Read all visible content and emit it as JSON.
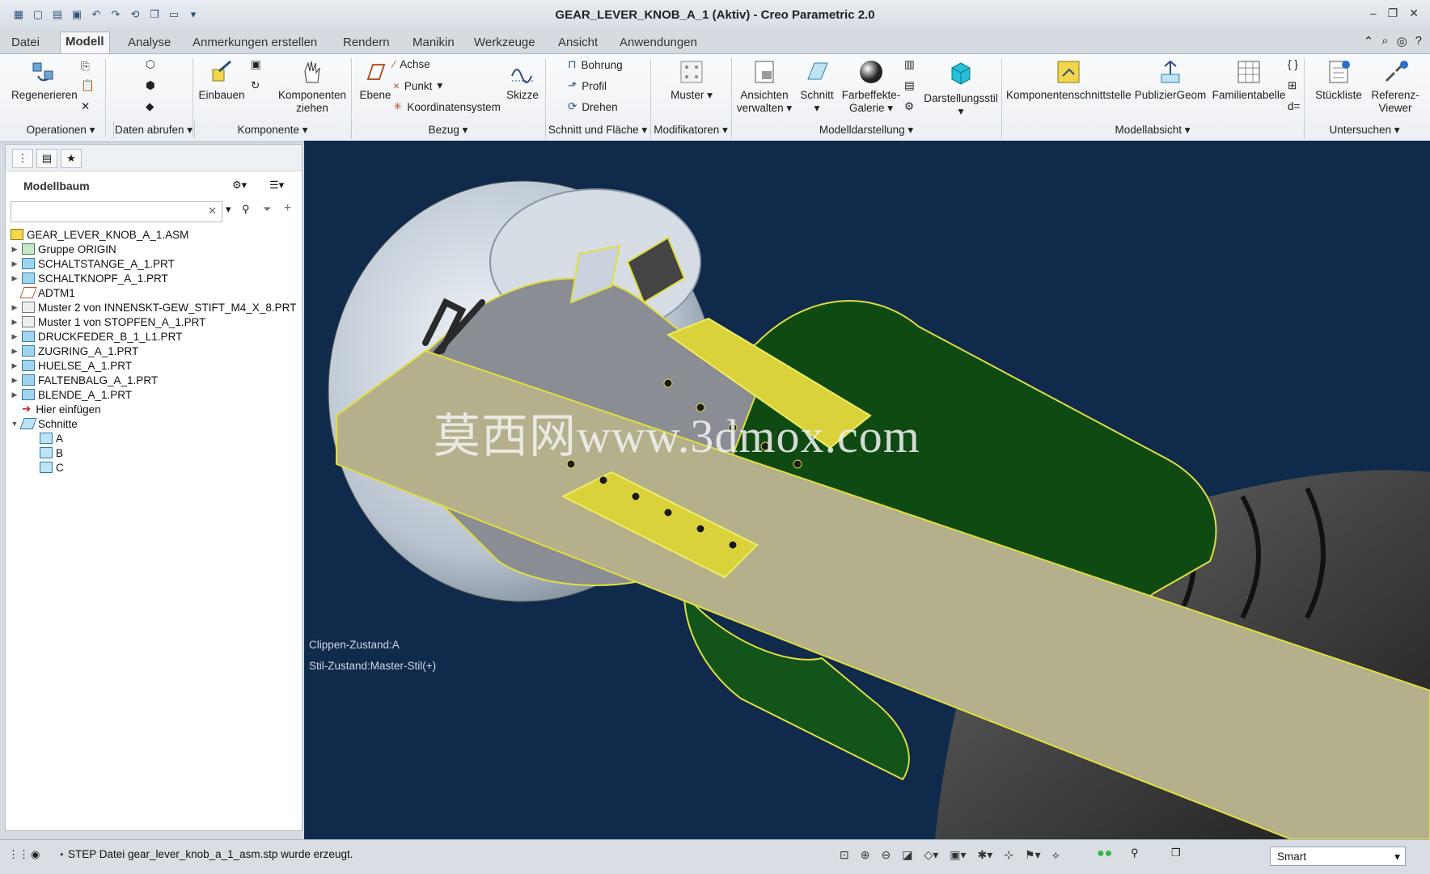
{
  "window": {
    "title": "GEAR_LEVER_KNOB_A_1 (Aktiv) - Creo Parametric 2.0"
  },
  "tabs": [
    "Datei",
    "Modell",
    "Analyse",
    "Anmerkungen erstellen",
    "Rendern",
    "Manikin",
    "Werkzeuge",
    "Ansicht",
    "Anwendungen"
  ],
  "ribbon": {
    "regenerieren": "Regenerieren",
    "einbauen": "Einbauen",
    "komponenten_ziehen_1": "Komponenten",
    "komponenten_ziehen_2": "ziehen",
    "ebene": "Ebene",
    "achse": "Achse",
    "punkt": "Punkt",
    "koordinatensystem": "Koordinatensystem",
    "skizze": "Skizze",
    "bohrung": "Bohrung",
    "profil": "Profil",
    "drehen": "Drehen",
    "muster": "Muster",
    "ansichten_1": "Ansichten",
    "ansichten_2": "verwalten",
    "schnitt": "Schnitt",
    "farbeffekte_1": "Farbeffekte-",
    "farbeffekte_2": "Galerie",
    "darstellungsstil": "Darstellungsstil",
    "komponentenschnittstelle": "Komponentenschnittstelle",
    "publiziergeom": "PublizierGeom",
    "familientabelle": "Familientabelle",
    "stueckliste": "Stückliste",
    "referenz_1": "Referenz-",
    "referenz_2": "Viewer",
    "d_eq": "d="
  },
  "groups": [
    "Operationen",
    "Daten abrufen",
    "Komponente",
    "Bezug",
    "Schnitt und Fläche",
    "Modifikatoren",
    "Modelldarstellung",
    "Modellabsicht",
    "Untersuchen"
  ],
  "modelltree": {
    "title": "Modellbaum",
    "items": [
      "GEAR_LEVER_KNOB_A_1.ASM",
      "Gruppe ORIGIN",
      "SCHALTSTANGE_A_1.PRT",
      "SCHALTKNOPF_A_1.PRT",
      "ADTM1",
      "Muster 2 von INNENSKT-GEW_STIFT_M4_X_8.PRT",
      "Muster 1 von STOPFEN_A_1.PRT",
      "DRUCKFEDER_B_1_L1.PRT",
      "ZUGRING_A_1.PRT",
      "HUELSE_A_1.PRT",
      "FALTENBALG_A_1.PRT",
      "BLENDE_A_1.PRT",
      "Hier einfügen",
      "Schnitte",
      "A",
      "B",
      "C"
    ]
  },
  "viewport": {
    "clip_state": "Clippen-Zustand:A",
    "style_state": "Stil-Zustand:Master-Stil(+)",
    "watermark": "莫西网www.3dmox.com"
  },
  "status": {
    "message": "STEP Datei gear_lever_knob_a_1_asm.stp wurde erzeugt.",
    "filter": "Smart"
  },
  "colors": {
    "viewport_bg": "#0f2a4b",
    "section_yellow": "#d9d23a",
    "section_green": "#0f4a12",
    "accent": "#2c4f7c"
  }
}
